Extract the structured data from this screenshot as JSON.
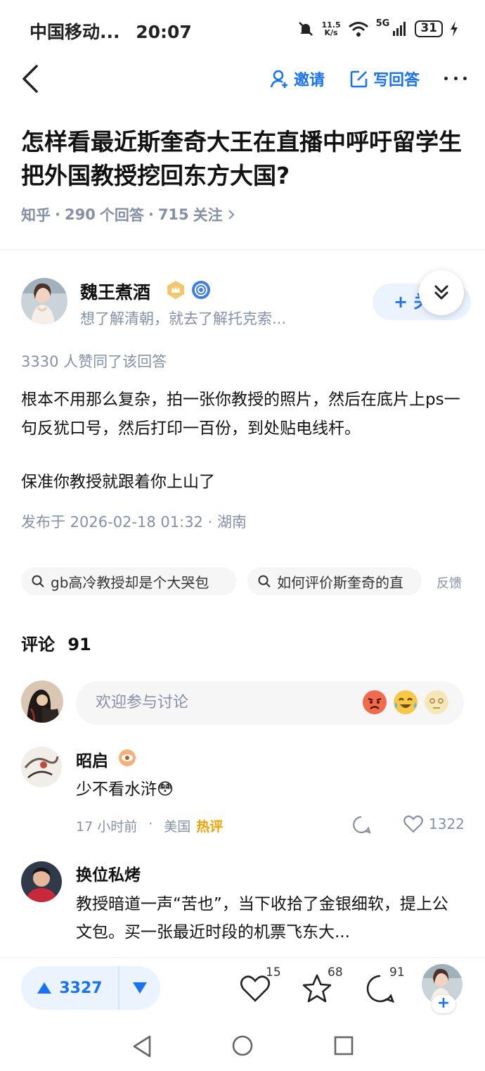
{
  "status_bar": {
    "carrier": "中国移动...",
    "time": "20:07",
    "net_speed_value": "11.5",
    "net_speed_unit": "K/s",
    "network_label": "5G",
    "battery": "31",
    "icons": [
      "bell-muted-icon",
      "wifi-icon",
      "signal-icon",
      "battery-icon",
      "charging-icon"
    ]
  },
  "header": {
    "invite_label": "邀请",
    "write_answer_label": "写回答"
  },
  "question": {
    "title": "怎样看最近斯奎奇大王在直播中呼吁留学生把外国教授挖回东方大国?",
    "source": "知乎",
    "answers_count": "290",
    "answers_label": "个回答",
    "followers_count": "715",
    "followers_label": "关注",
    "sep": "·"
  },
  "answer": {
    "author_name": "魏王煮酒",
    "author_bio": "想了解清朝，就去了解托克索...",
    "follow_label": "+ 关注",
    "upvote_summary": "3330 人赞同了该回答",
    "paragraphs": [
      "根本不用那么复杂，拍一张你教授的照片，然后在底片上ps一句反犹口号，然后打印一百份，到处贴电线杆。",
      "保准你教授就跟着你上山了"
    ],
    "publish_info": "发布于 2026-02-18 01:32 · 湖南"
  },
  "related_searches": {
    "items": [
      "gb高冷教授却是个大哭包",
      "如何评价斯奎奇的直"
    ],
    "feedback_label": "反馈"
  },
  "comments": {
    "title": "评论",
    "count": "91",
    "input_placeholder": "欢迎参与讨论",
    "items": [
      {
        "name": "昭启",
        "text": "少不看水浒😳",
        "time": "17 小时前",
        "sep": "·",
        "location": "美国",
        "tag": "热评",
        "likes": "1322"
      },
      {
        "name": "换位私烤",
        "text": "教授暗道一声“苦也”，当下收拾了金银细软，提上公文包。买一张最近时段的机票飞东大..."
      }
    ]
  },
  "bottom_bar": {
    "upvotes": "3327",
    "likes": "15",
    "favorites": "68",
    "comments": "91",
    "plus": "+"
  },
  "colors": {
    "accent": "#1772f6",
    "muted": "#8590a6",
    "hot": "#f1a200"
  }
}
